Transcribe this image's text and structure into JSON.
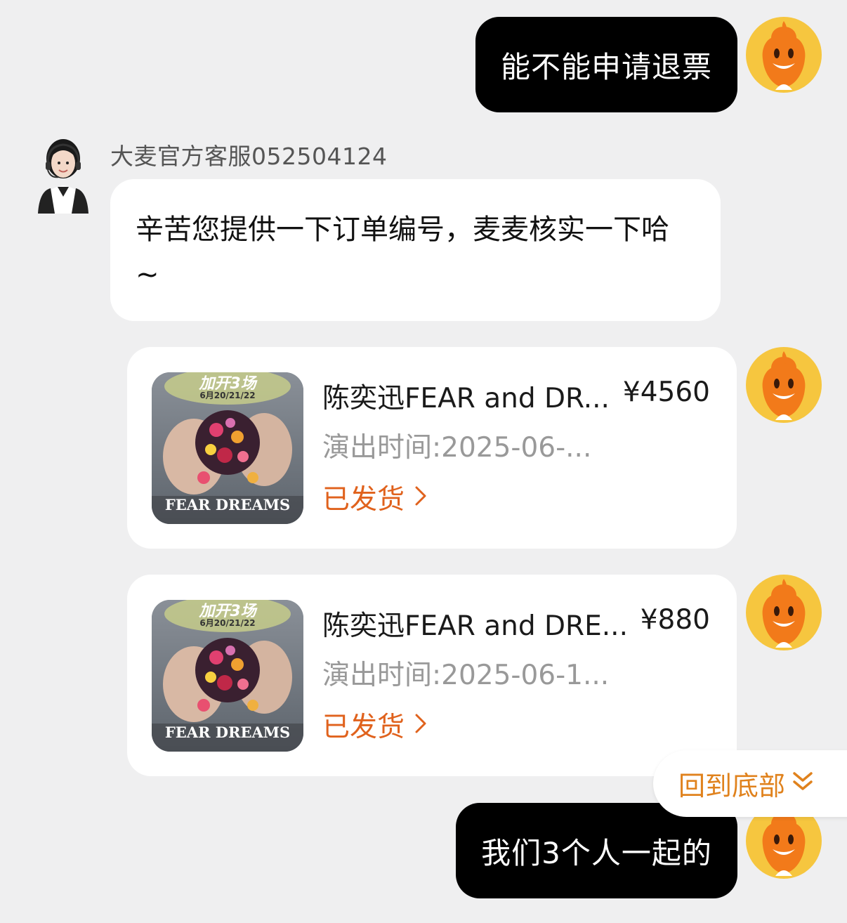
{
  "messages": {
    "user_1": "能不能申请退票",
    "agent_name": "大麦官方客服052504124",
    "agent_reply": "辛苦您提供一下订单编号，麦麦核实一下哈~",
    "user_2": "我们3个人一起的"
  },
  "orders": [
    {
      "title": "陈奕迅FEAR and DR...",
      "price": "¥4560",
      "time": "演出时间:2025-06-...",
      "status": "已发货",
      "poster_top": "加开3场",
      "poster_dates": "6月20/21/22",
      "poster_bottom": "FEAR DREAMS"
    },
    {
      "title": "陈奕迅FEAR and DRE...",
      "price": "¥880",
      "time": "演出时间:2025-06-1...",
      "status": "已发货",
      "poster_top": "加开3场",
      "poster_dates": "6月20/21/22",
      "poster_bottom": "FEAR DREAMS"
    }
  ],
  "back_to_bottom": "回到底部",
  "colors": {
    "background": "#efeff0",
    "user_bubble": "#000000",
    "status_orange": "#e0621d",
    "mascot_yellow": "#f6c63f"
  },
  "icons": {
    "status_chevron": "chevron-right-icon",
    "back_to_bottom": "double-chevron-down-icon"
  }
}
